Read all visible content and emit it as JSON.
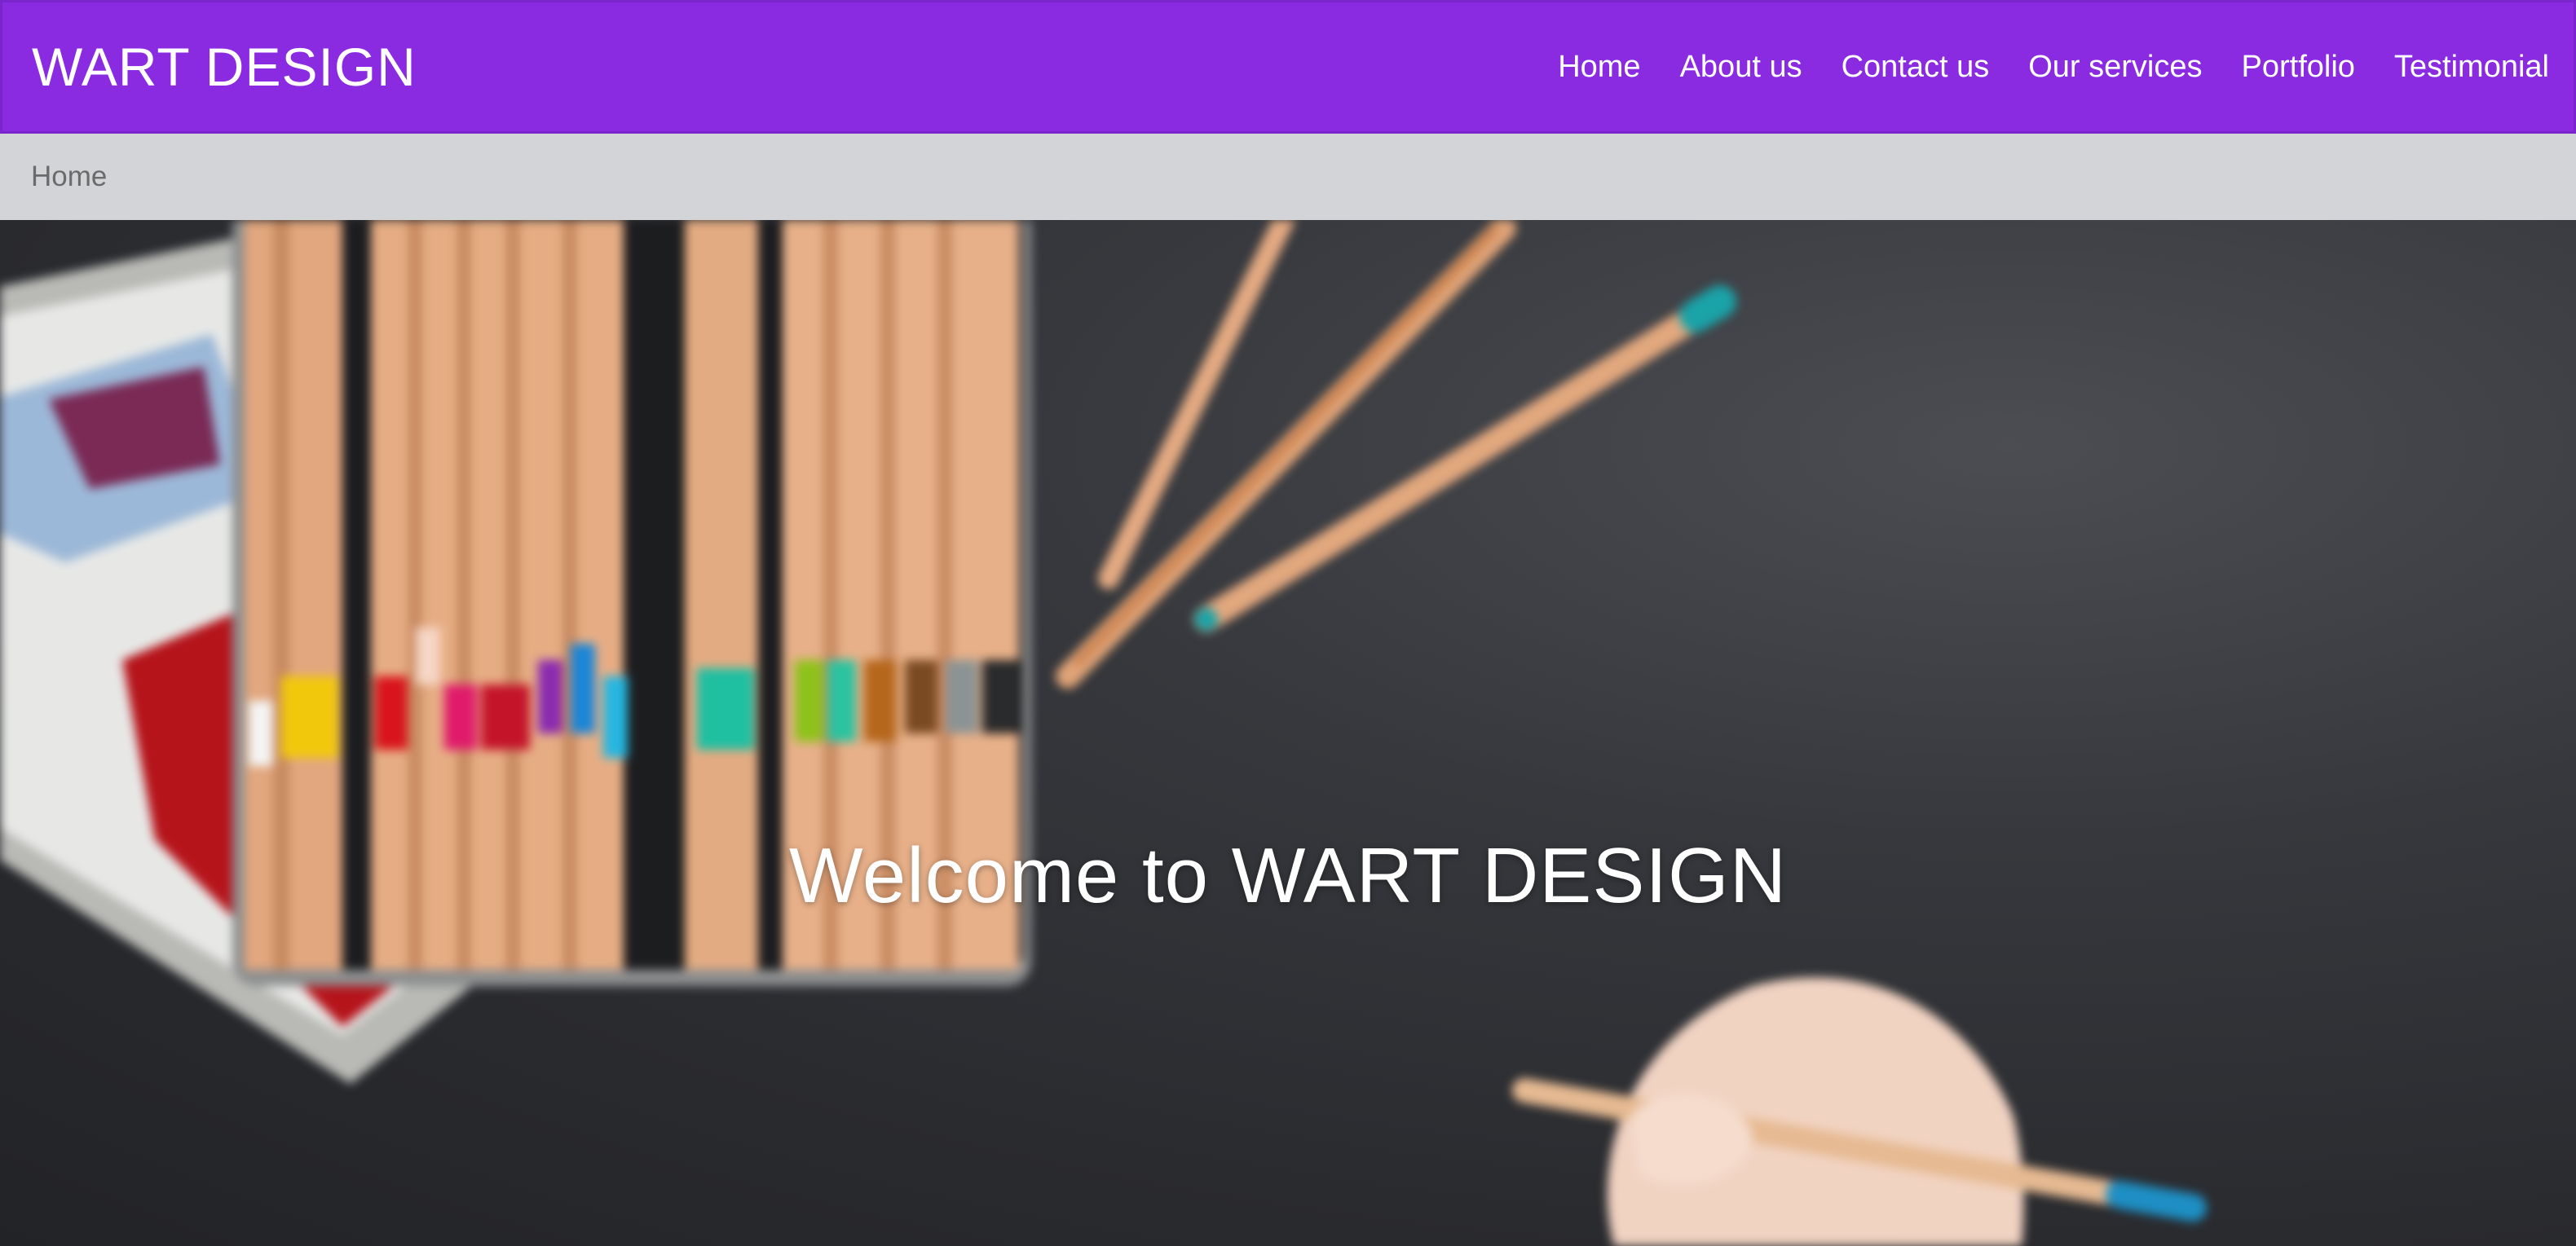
{
  "navbar": {
    "brand": "WART DESIGN",
    "links": [
      {
        "label": "Home"
      },
      {
        "label": "About us"
      },
      {
        "label": "Contact us"
      },
      {
        "label": "Our services"
      },
      {
        "label": "Portfolio"
      },
      {
        "label": "Testimonial"
      }
    ]
  },
  "breadcrumb": {
    "items": [
      {
        "label": "Home"
      }
    ]
  },
  "hero": {
    "title": "Welcome to WART DESIGN"
  },
  "colors": {
    "navbar_bg": "#8a2be2",
    "breadcrumb_bg": "#d2d4d8",
    "hero_bg": "#2e2f33"
  }
}
